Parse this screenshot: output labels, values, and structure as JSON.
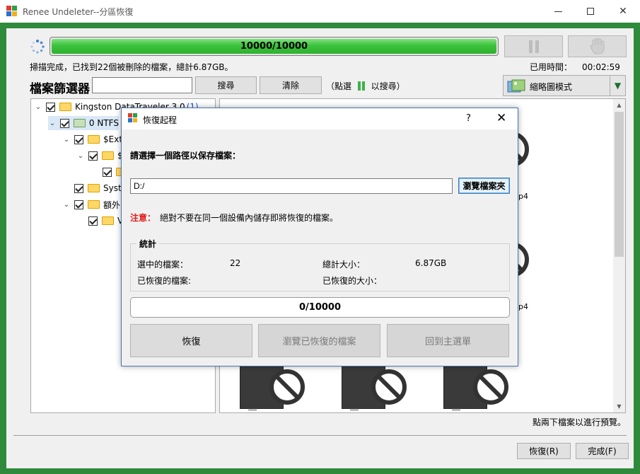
{
  "window": {
    "title": "Renee Undeleter--分區恢復",
    "controls": [
      "minimize",
      "maximize",
      "close"
    ]
  },
  "scan": {
    "progress_label": "10000/10000",
    "progress_fraction": 1.0,
    "status_text": "掃描完成，已找到22個被刪除的檔案，總計6.87GB。",
    "elapsed_label": "已用時間：",
    "elapsed_value": "00:02:59"
  },
  "filter": {
    "title": "檔案篩選器",
    "input_value": "",
    "search_label": "搜尋",
    "clear_label": "清除",
    "hint_prefix": "（點選",
    "hint_suffix": "以搜尋）"
  },
  "view_mode": {
    "label": "縮略圖模式"
  },
  "tree": {
    "nodes": [
      {
        "label": "Kingston DataTraveler 3.0",
        "count": "(1)"
      },
      {
        "label": "0 NTFS",
        "count": ""
      },
      {
        "label": "$Ext",
        "count": ""
      },
      {
        "label": "$",
        "count": ""
      },
      {
        "label": "",
        "count": ""
      },
      {
        "label": "Syst",
        "count": ""
      },
      {
        "label": "額外",
        "count": ""
      },
      {
        "label": "V",
        "count": ""
      }
    ]
  },
  "preview": {
    "fragment_1": "p4",
    "fragment_2": "p4",
    "double_click_hint": "點兩下檔案以進行預覽。"
  },
  "bottom": {
    "recover_label": "恢復(R)",
    "done_label": "完成(F)"
  },
  "dialog": {
    "title": "恢復起程",
    "help": "?",
    "close": "✕",
    "prompt": "請選擇一個路徑以保存檔案：",
    "path_value": "D:/",
    "browse_label": "瀏覽檔案夾",
    "warning_label": "注意：",
    "warning_text": "絕對不要在同一個設備內儲存即將恢復的檔案。",
    "stats_title": "統計",
    "selected_files_label": "選中的檔案：",
    "selected_files_value": "22",
    "total_size_label": "總計大小：",
    "total_size_value": "6.87GB",
    "recovered_files_label": "已恢復的檔案:",
    "recovered_files_value": "",
    "recovered_size_label": "已恢復的大小：",
    "recovered_size_value": "",
    "progress_label": "0/10000",
    "progress_fraction": 0,
    "recover_button": "恢復",
    "browse_recovered_button": "瀏覽已恢復的檔案",
    "back_button": "回到主選單"
  },
  "colors": {
    "accent_green": "#2f8a3c",
    "progress_green": "#3cc23c",
    "warning_red": "#e01b1b",
    "tree_count_blue": "#2255bb"
  }
}
